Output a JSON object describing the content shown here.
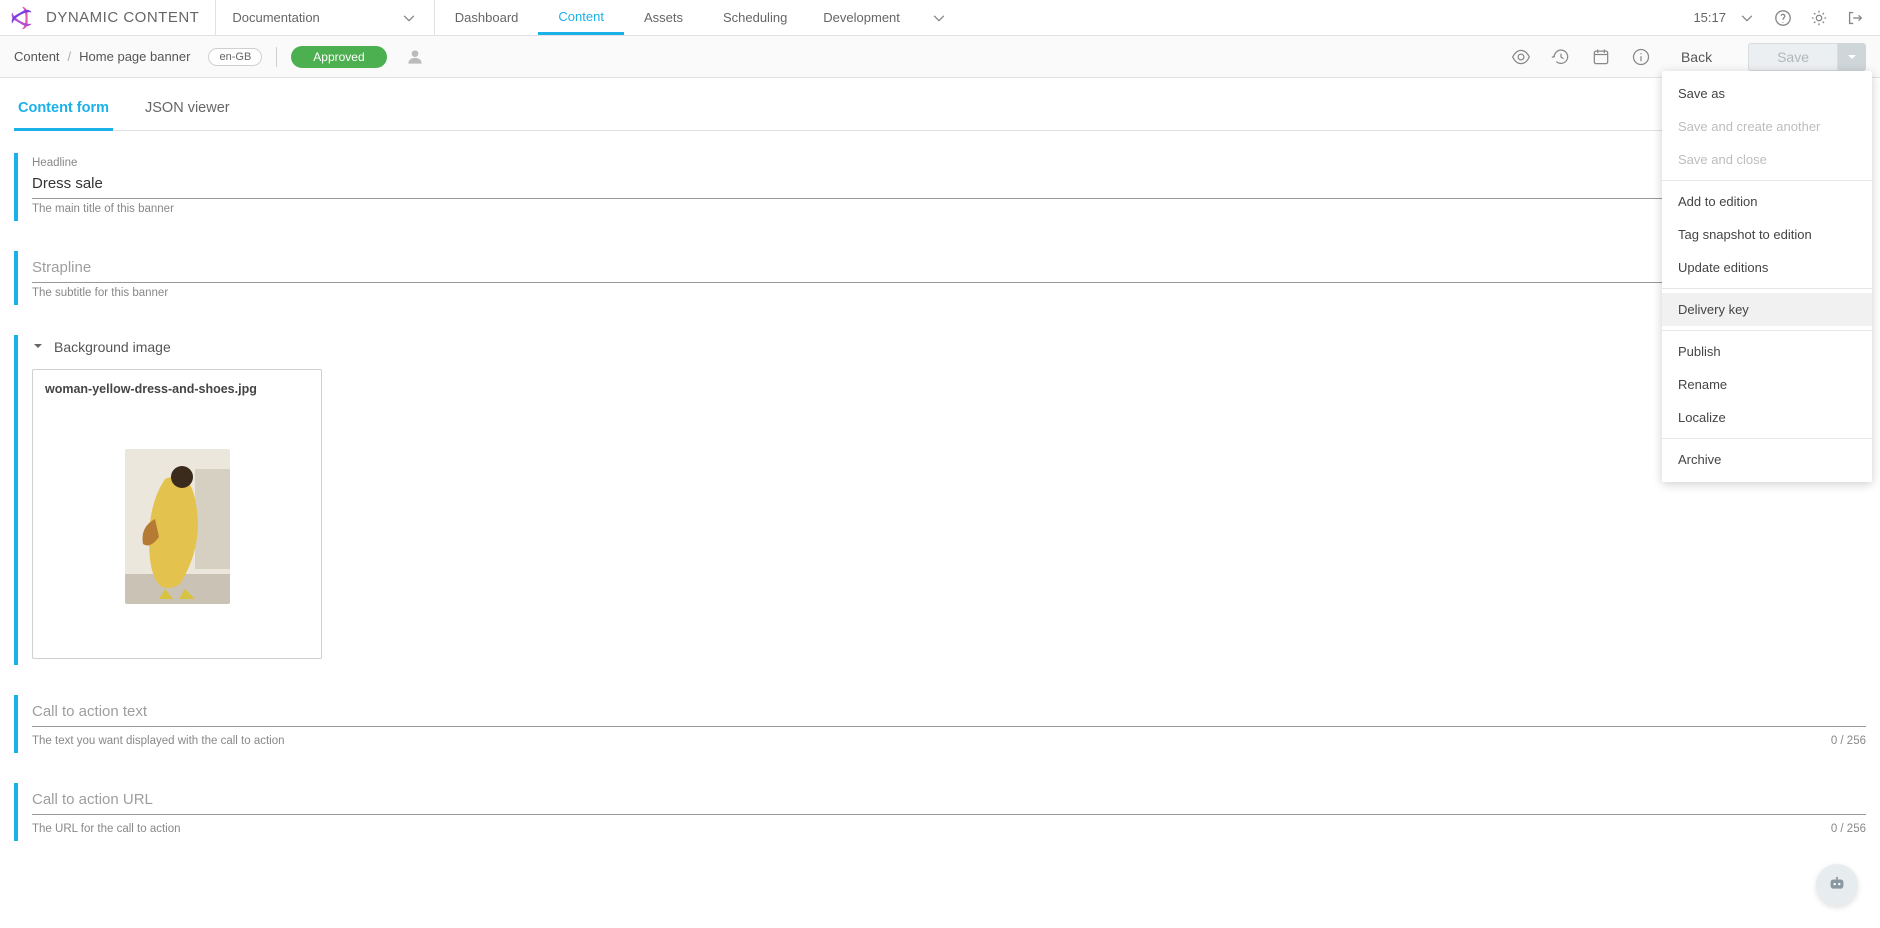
{
  "brand": {
    "text": "DYNAMIC CONTENT"
  },
  "topnav": {
    "documentation_label": "Documentation",
    "tabs": [
      {
        "label": "Dashboard",
        "active": false
      },
      {
        "label": "Content",
        "active": true
      },
      {
        "label": "Assets",
        "active": false
      },
      {
        "label": "Scheduling",
        "active": false
      }
    ],
    "environment_label": "Development",
    "time": "15:17"
  },
  "toolbar": {
    "root_label": "Content",
    "current_label": "Home page banner",
    "locale": "en-GB",
    "status": "Approved",
    "back_label": "Back",
    "save_label": "Save"
  },
  "form_tabs": {
    "content_form": "Content form",
    "json_viewer": "JSON viewer"
  },
  "fields": {
    "headline": {
      "label": "Headline",
      "value": "Dress sale",
      "help": "The main title of this banner"
    },
    "strapline": {
      "placeholder": "Strapline",
      "help": "The subtitle for this banner"
    },
    "background": {
      "section_label": "Background image",
      "filename": "woman-yellow-dress-and-shoes.jpg"
    },
    "cta_text": {
      "placeholder": "Call to action text",
      "help": "The text you want displayed with the call to action",
      "counter": "0 / 256"
    },
    "cta_url": {
      "placeholder": "Call to action URL",
      "help": "The URL for the call to action",
      "counter": "0 / 256"
    }
  },
  "save_menu": {
    "items": [
      {
        "label": "Save as",
        "state": "normal"
      },
      {
        "label": "Save and create another",
        "state": "disabled"
      },
      {
        "label": "Save and close",
        "state": "disabled"
      },
      {
        "sep": true
      },
      {
        "label": "Add to edition",
        "state": "normal"
      },
      {
        "label": "Tag snapshot to edition",
        "state": "normal"
      },
      {
        "label": "Update editions",
        "state": "normal"
      },
      {
        "sep": true
      },
      {
        "label": "Delivery key",
        "state": "highlight"
      },
      {
        "sep": true
      },
      {
        "label": "Publish",
        "state": "normal"
      },
      {
        "label": "Rename",
        "state": "normal"
      },
      {
        "label": "Localize",
        "state": "normal"
      },
      {
        "sep": true
      },
      {
        "label": "Archive",
        "state": "normal"
      }
    ]
  }
}
